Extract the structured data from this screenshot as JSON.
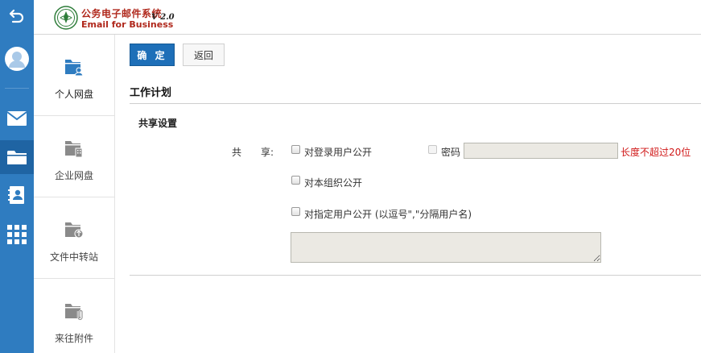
{
  "header": {
    "logo_cn": "公务电子邮件系统",
    "logo_en": "Email for Business",
    "version": "V 2.0"
  },
  "rail": {
    "items": [
      {
        "icon": "back-arrow-icon"
      },
      {
        "icon": "avatar-icon"
      },
      {
        "icon": "mail-icon"
      },
      {
        "icon": "folder-icon",
        "active": true
      },
      {
        "icon": "contacts-icon"
      },
      {
        "icon": "apps-grid-icon"
      }
    ]
  },
  "side2": {
    "items": [
      {
        "label": "个人网盘",
        "icon": "personal-drive-icon",
        "active": true
      },
      {
        "label": "企业网盘",
        "icon": "enterprise-drive-icon"
      },
      {
        "label": "文件中转站",
        "icon": "file-transfer-icon"
      },
      {
        "label": "来往附件",
        "icon": "attachments-icon"
      }
    ]
  },
  "toolbar": {
    "ok_label": "确 定",
    "back_label": "返回"
  },
  "main": {
    "title": "工作计划",
    "subtitle": "共享设置",
    "share_label": "共　　享:",
    "options": {
      "login_public": "对登录用户公开",
      "password": "密码",
      "password_value": "",
      "password_hint": "长度不超过20位",
      "org_public": "对本组织公开",
      "specific_public": "对指定用户公开 (以逗号\",\"分隔用户名)",
      "specific_users_value": ""
    }
  },
  "colors": {
    "rail": "#2f7cc0",
    "rail_active": "#1f64a3",
    "primary_button": "#1e6fb8",
    "logo_red": "#b0281c",
    "hint_red": "#d01818",
    "input_bg": "#ebe9e3"
  }
}
